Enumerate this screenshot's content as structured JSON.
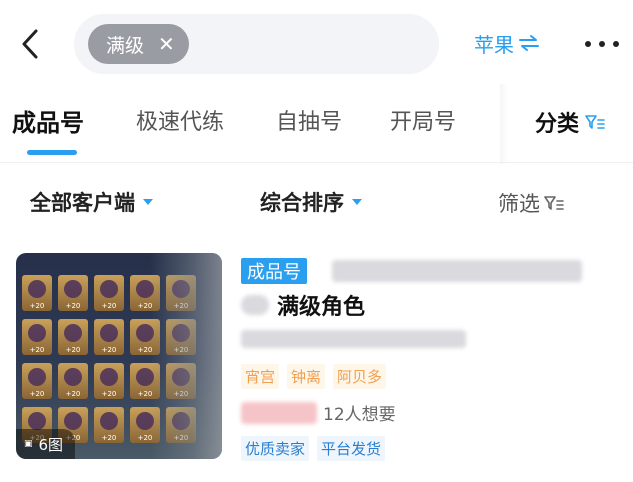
{
  "search": {
    "chip_label": "满级",
    "chip_remove": "✕"
  },
  "platform": {
    "label": "苹果"
  },
  "tabs": [
    {
      "label": "成品号",
      "active": true
    },
    {
      "label": "极速代练",
      "active": false
    },
    {
      "label": "自抽号",
      "active": false
    },
    {
      "label": "开局号",
      "active": false
    }
  ],
  "category_label": "分类",
  "filters": {
    "client": "全部客户端",
    "sort": "综合排序",
    "screen": "筛选"
  },
  "listing": {
    "photo_count": "6图",
    "type_badge": "成品号",
    "title": "满级角色",
    "tags": [
      "宵宫",
      "钟离",
      "阿贝多"
    ],
    "wants": "12人想要",
    "badges": [
      "优质卖家",
      "平台发货"
    ]
  },
  "colors": {
    "accent": "#2a9ff0",
    "tag_text": "#f0a050"
  }
}
